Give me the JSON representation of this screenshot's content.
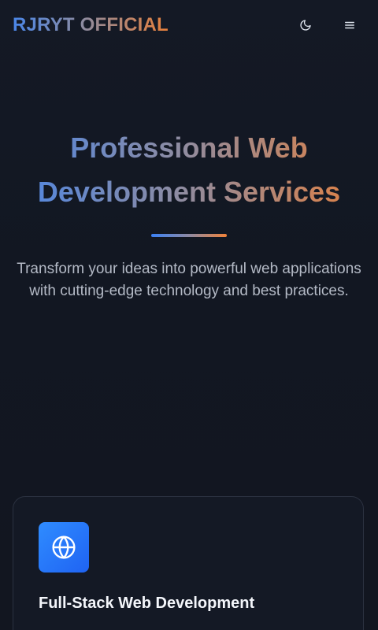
{
  "header": {
    "brand": "RJRYT OFFICIAL",
    "theme_toggle_icon": "moon-icon",
    "menu_icon": "hamburger-menu-icon"
  },
  "hero": {
    "title": "Professional Web Development Services",
    "subtitle": "Transform your ideas into powerful web applications with cutting-edge technology and best practices."
  },
  "services": [
    {
      "icon": "globe-icon",
      "title": "Full-Stack Web Development"
    }
  ],
  "colors": {
    "background": "#121621",
    "gradient_start": "#4a86e8",
    "gradient_mid": "#8d8ba0",
    "gradient_end": "#e8803b",
    "card_border": "#2b3140",
    "card_icon_bg": "#2f8cff",
    "text_primary": "#f4f6fb",
    "text_secondary": "#b4bac6"
  }
}
